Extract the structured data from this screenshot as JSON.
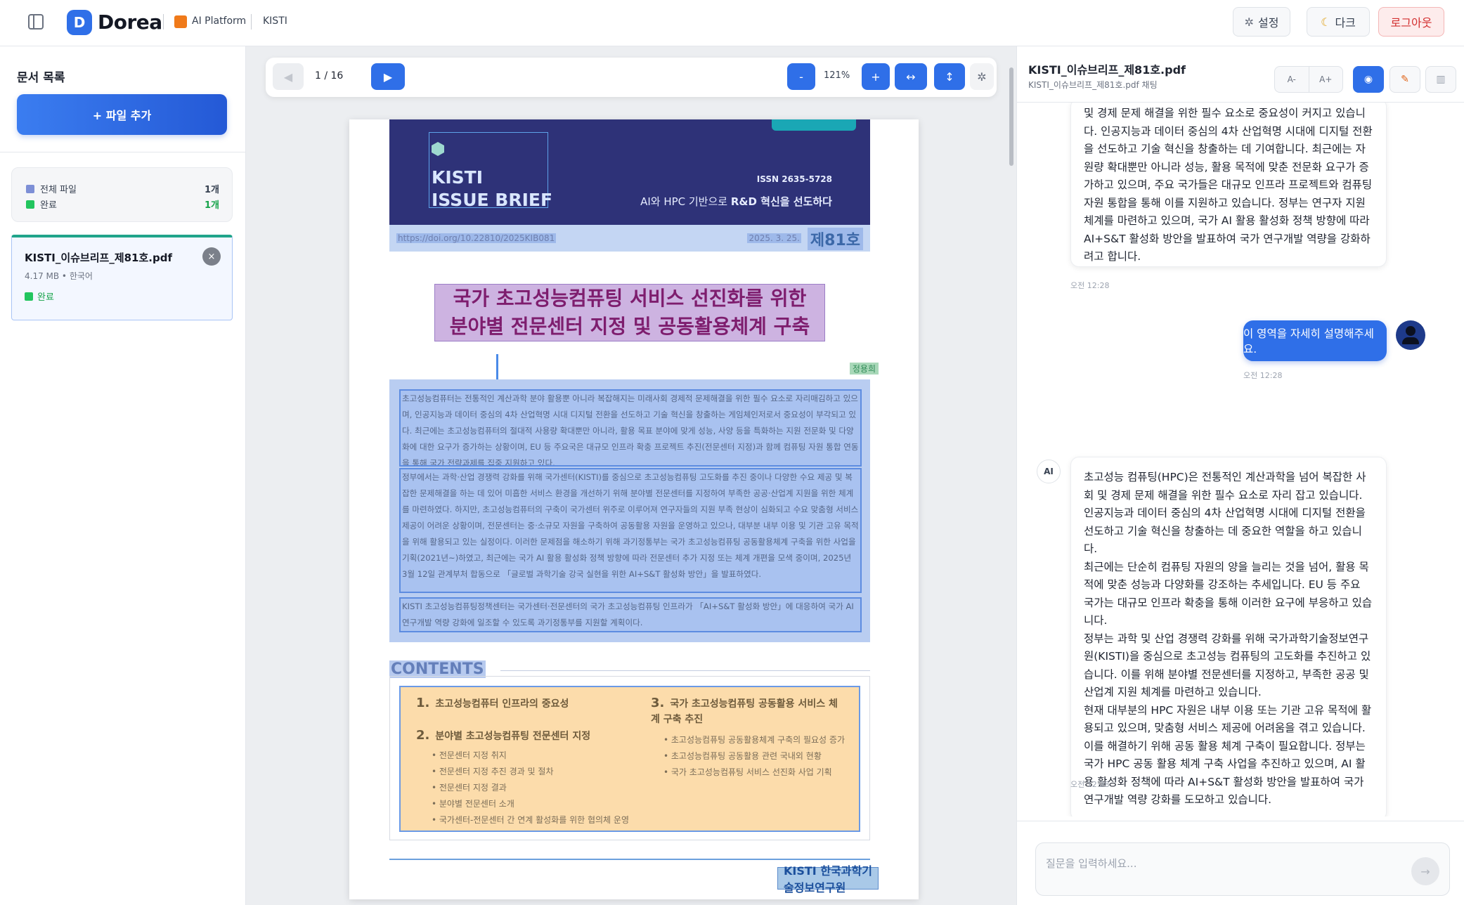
{
  "topbar": {
    "logo_letter": "D",
    "app_name": "Dorea",
    "platform": "AI Platform",
    "org": "KISTI",
    "settings_label": "설정",
    "dark_label": "다크",
    "logout_label": "로그아웃"
  },
  "sidebar": {
    "title": "문서 목록",
    "add_file_label": "+ 파일 추가",
    "stats": [
      {
        "label": "전체 파일",
        "value": "1개",
        "color": "#1f2430"
      },
      {
        "label": "완료",
        "value": "1개",
        "color": "#16a34a"
      }
    ],
    "files": [
      {
        "name": "KISTI_이슈브리프_제81호.pdf",
        "meta": "4.17 MB • 한국어",
        "status": "완료"
      }
    ]
  },
  "viewer": {
    "page_indicator": "1 / 16",
    "zoom": "121%",
    "prev_icon": "◀",
    "next_icon": "▶",
    "zoom_out_icon": "-",
    "zoom_in_icon": "+",
    "fit_width_icon": "↔",
    "fit_height_icon": "↕",
    "settings_icon": "gear",
    "page": {
      "brand_line1": "KISTI",
      "brand_line2": "ISSUE BRIEF",
      "issn": "ISSN 2635-5728",
      "subtitle_pre": "AI와 HPC 기반으로 ",
      "subtitle_bold": "R&D 혁신을 선도하다",
      "doi": "https://doi.org/10.22810/2025KIB081",
      "date": "2025. 3. 25.",
      "issue_no": "제81호",
      "title_line1": "국가 초고성능컴퓨팅 서비스 선진화를 위한",
      "title_line2": "분야별 전문센터 지정 및 공동활용체계 구축",
      "tag": "정용희",
      "para1": "초고성능컴퓨터는 전통적인 계산과학 분야 활용뿐 아니라 복잡해지는 미래사회 경제적 문제해결을 위한 필수 요소로 자리매김하고 있으며, 인공지능과 데이터 중심의 4차 산업혁명 시대 디지털 전환을 선도하고 기술 혁신을 창출하는 게임체인저로서 중요성이 부각되고 있다. 최근에는 초고성능컴퓨터의 절대적 사용량 확대뿐만 아니라, 활용 목표 분야에 맞게 성능, 사양 등을 특화하는 지원 전문화 및 다양화에 대한 요구가 증가하는 상황이며, EU 등 주요국은 대규모 인프라 확충 프로젝트 추진(전문센터 지정)과 함께 컴퓨팅 자원 통합 연동을 통해 국가 전략과제를 집중 지원하고 있다.",
      "para2": "정부에서는 과학·산업 경쟁력 강화를 위해 국가센터(KISTI)를 중심으로 초고성능컴퓨팅 고도화를 추진 중이나 다양한 수요 제공 및 복잡한 문제해결을 하는 데 있어 미흡한 서비스 환경을 개선하기 위해 분야별 전문센터를 지정하여 부족한 공공·산업계 지원을 위한 체계를 마련하였다. 하지만, 초고성능컴퓨터의 구축이 국가센터 위주로 이루어져 연구자들의 지원 부족 현상이 심화되고 수요 맞춤형 서비스 제공이 어려운 상황이며, 전문센터는 중·소규모 자원을 구축하여 공동활용 자원을 운영하고 있으나, 대부분 내부 이용 및 기관 고유 목적을 위해 활용되고 있는 실정이다. 이러한 문제점을 해소하기 위해 과기정통부는 국가 초고성능컴퓨팅 공동활용체계 구축을 위한 사업을 기획(2021년~)하였고, 최근에는 국가 AI 활용 활성화 정책 방향에 따라 전문센터 추가 지정 또는 체계 개편을 모색 중이며, 2025년 3월 12일 관계부처 합동으로 「글로벌 과학기술 강국 실현을 위한 AI+S&T 활성화 방안」을 발표하였다.",
      "para3": "KISTI 초고성능컴퓨팅정책센터는 국가센터·전문센터의 국가 초고성능컴퓨팅 인프라가 「AI+S&T 활성화 방안」에 대응하여 국가 AI 연구개발 역량 강화에 일조할 수 있도록 과기정통부를 지원할 계획이다.",
      "contents_title": "CONTENTS",
      "toc": [
        {
          "num": "1.",
          "title": "초고성능컴퓨터 인프라의 중요성",
          "subs": []
        },
        {
          "num": "2.",
          "title": "분야별 초고성능컴퓨팅 전문센터 지정",
          "subs": [
            "• 전문센터 지정 취지",
            "• 전문센터 지정 추진 경과 및 절차",
            "• 전문센터 지정 결과",
            "• 분야별 전문센터 소개",
            "• 국가센터-전문센터 간 연계 활성화를 위한 협의체 운영"
          ]
        },
        {
          "num": "3.",
          "title": "국가 초고성능컴퓨팅 공동활용 서비스 체계 구축 추진",
          "subs": [
            "• 초고성능컴퓨팅 공동활용체계 구축의 필요성 증가",
            "• 초고성능컴퓨팅 공동활용 관련 국내외 현황",
            "• 국가 초고성능컴퓨팅 서비스 선진화 사업 기획"
          ]
        }
      ],
      "footer_logo": "KISTI 한국과학기술정보연구원"
    }
  },
  "chat": {
    "title": "KISTI_이슈브리프_제81호.pdf",
    "subtitle": "KISTI_이슈브리프_제81호.pdf 채팅",
    "font_down": "A-",
    "font_up": "A+",
    "messages": {
      "ai_first": "및 경제 문제 해결을 위한 필수 요소로 중요성이 커지고 있습니다. 인공지능과 데이터 중심의 4차 산업혁명 시대에 디지털 전환을 선도하고 기술 혁신을 창출하는 데 기여합니다. 최근에는 자원량 확대뿐만 아니라 성능, 활용 목적에 맞춘 전문화 요구가 증가하고 있으며, 주요 국가들은 대규모 인프라 프로젝트와 컴퓨팅 자원 통합을 통해 이를 지원하고 있습니다. 정부는 연구자 지원 체계를 마련하고 있으며, 국가 AI 활용 활성화 정책 방향에 따라 AI+S&T 활성화 방안을 발표하여 국가 연구개발 역량을 강화하려고 합니다.",
      "ai_first_time": "오전 12:28",
      "user": "이 영역을 자세히 설명해주세요.",
      "user_time": "오전 12:28",
      "ai_label": "AI",
      "ai_second_p1": "초고성능 컴퓨팅(HPC)은 전통적인 계산과학을 넘어 복잡한 사회 및 경제 문제 해결을 위한 필수 요소로 자리 잡고 있습니다. 인공지능과 데이터 중심의 4차 산업혁명 시대에 디지털 전환을 선도하고 기술 혁신을 창출하는 데 중요한 역할을 하고 있습니다.",
      "ai_second_p2": "최근에는 단순히 컴퓨팅 자원의 양을 늘리는 것을 넘어, 활용 목적에 맞춘 성능과 다양화를 강조하는 추세입니다. EU 등 주요 국가는 대규모 인프라 확충을 통해 이러한 요구에 부응하고 있습니다.",
      "ai_second_p3": "정부는 과학 및 산업 경쟁력 강화를 위해 국가과학기술정보연구원(KISTI)을 중심으로 초고성능 컴퓨팅의 고도화를 추진하고 있습니다. 이를 위해 분야별 전문센터를 지정하고, 부족한 공공 및 산업계 지원 체계를 마련하고 있습니다.",
      "ai_second_p4": "현재 대부분의 HPC 자원은 내부 이용 또는 기관 고유 목적에 활용되고 있으며, 맞춤형 서비스 제공에 어려움을 겪고 있습니다. 이를 해결하기 위해 공동 활용 체계 구축이 필요합니다. 정부는 국가 HPC 공동 활용 체계 구축 사업을 추진하고 있으며, AI 활용 활성화 정책에 따라 AI+S&T 활성화 방안을 발표하여 국가 연구개발 역량 강화를 도모하고 있습니다.",
      "ai_second_time": "오전 12:28"
    },
    "input_placeholder": "질문을 입력하세요...",
    "send_icon": "→"
  }
}
